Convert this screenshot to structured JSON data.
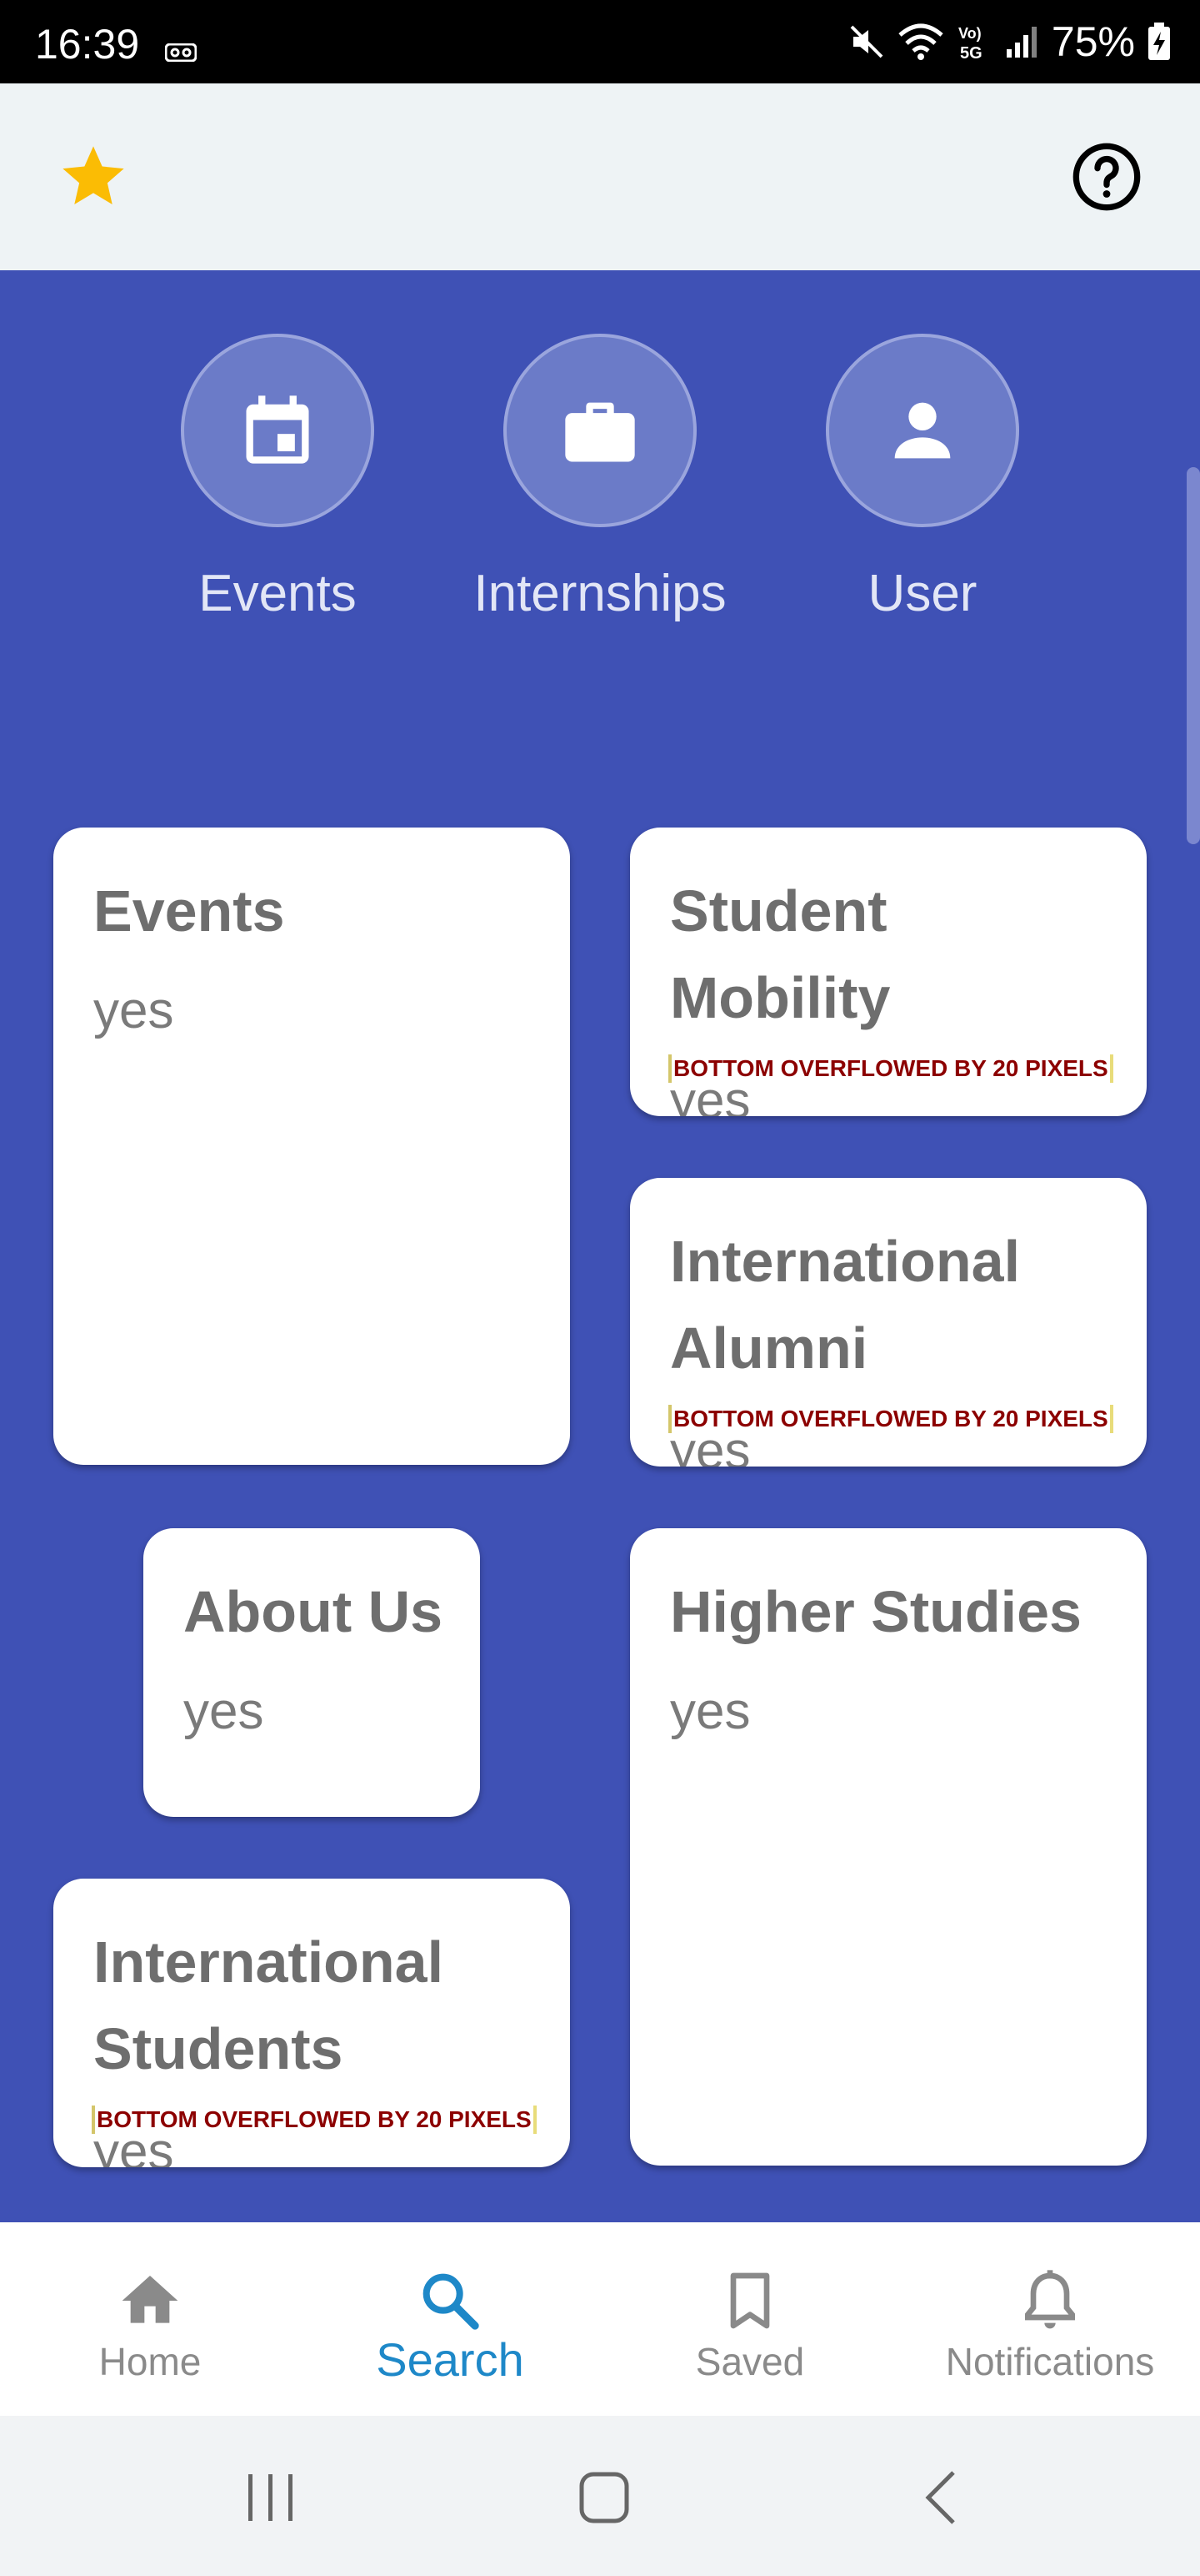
{
  "status_bar": {
    "time": "16:39",
    "battery": "75%",
    "icons": [
      "voicemail-icon",
      "mute-icon",
      "wifi-icon",
      "volte-5g-icon",
      "signal-icon",
      "battery-charging-icon"
    ]
  },
  "app_bar": {
    "left_icon": "star-icon",
    "right_icon": "help-circle-icon",
    "accent": "#fbbc04"
  },
  "quick_actions": [
    {
      "label": "Events",
      "icon": "calendar-icon"
    },
    {
      "label": "Internships",
      "icon": "briefcase-icon"
    },
    {
      "label": "User",
      "icon": "person-icon"
    }
  ],
  "cards": [
    {
      "title": "Events",
      "subtitle": "yes"
    },
    {
      "title": "Student Mobility",
      "subtitle": "yes",
      "overflow": "BOTTOM OVERFLOWED BY 20 PIXELS"
    },
    {
      "title": "International Alumni",
      "subtitle": "yes",
      "overflow": "BOTTOM OVERFLOWED BY 20 PIXELS"
    },
    {
      "title": "About Us",
      "subtitle": "yes"
    },
    {
      "title": "Higher Studies",
      "subtitle": "yes"
    },
    {
      "title": "International Students",
      "subtitle": "yes",
      "overflow": "BOTTOM OVERFLOWED BY 20 PIXELS"
    }
  ],
  "bottom_nav": [
    {
      "label": "Home",
      "icon": "home-icon",
      "active": false
    },
    {
      "label": "Search",
      "icon": "search-icon",
      "active": true
    },
    {
      "label": "Saved",
      "icon": "bookmark-icon",
      "active": false
    },
    {
      "label": "Notifications",
      "icon": "bell-icon",
      "active": false
    }
  ],
  "colors": {
    "primary": "#3f51b5",
    "nav_active": "#1e88c8",
    "overflow_text": "#8c0000"
  }
}
